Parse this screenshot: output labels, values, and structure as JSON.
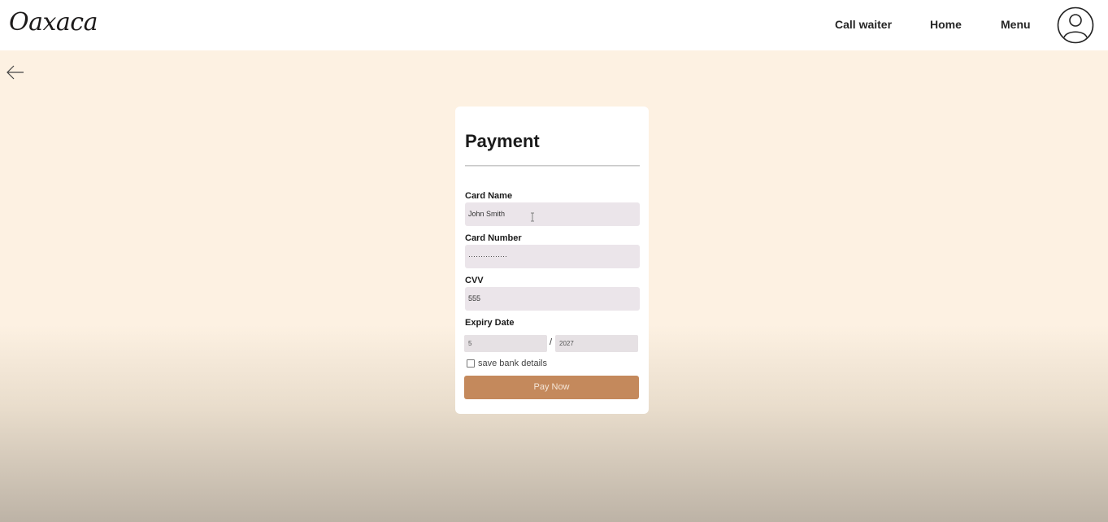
{
  "header": {
    "logo": "Oaxaca",
    "nav": {
      "call_waiter": "Call waiter",
      "home": "Home",
      "menu": "Menu"
    },
    "avatar_icon": "user-circle-icon"
  },
  "back_icon": "arrow-left-icon",
  "payment": {
    "title": "Payment",
    "card_name_label": "Card Name",
    "card_name_value": "John Smith",
    "card_number_label": "Card Number",
    "card_number_value": "················",
    "cvv_label": "CVV",
    "cvv_value": "555",
    "expiry_label": "Expiry Date",
    "expiry_month": "5",
    "expiry_separator": "/",
    "expiry_year": "2027",
    "save_details_label": "save bank details",
    "save_details_checked": false,
    "pay_button": "Pay Now"
  },
  "colors": {
    "background": "#fdf1e2",
    "pay_button": "#c4895c",
    "field": "#ebe5ea"
  }
}
